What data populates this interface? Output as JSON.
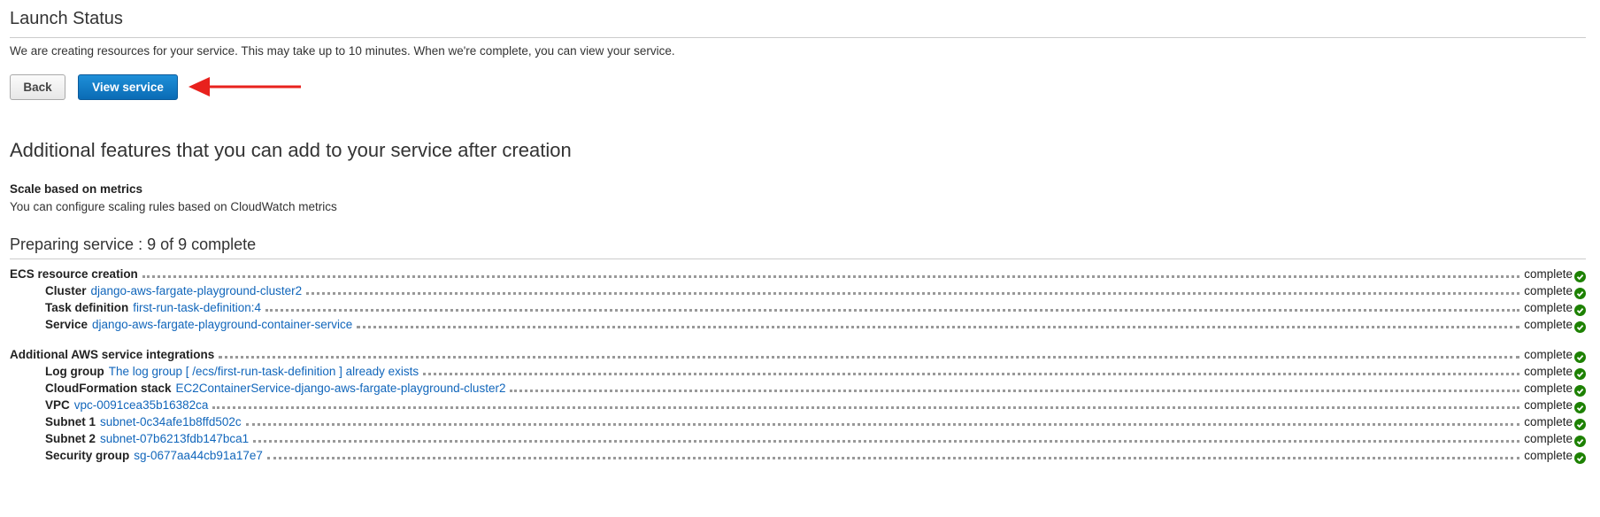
{
  "launch": {
    "title": "Launch Status",
    "description": "We are creating resources for your service. This may take up to 10 minutes. When we're complete, you can view your service.",
    "back_label": "Back",
    "view_label": "View service"
  },
  "additional": {
    "title": "Additional features that you can add to your service after creation",
    "scale_title": "Scale based on metrics",
    "scale_desc": "You can configure scaling rules based on CloudWatch metrics"
  },
  "preparing": {
    "title": "Preparing service : 9 of 9 complete",
    "ecs": {
      "label": "ECS resource creation",
      "status": "complete",
      "items": [
        {
          "label": "Cluster",
          "value": "django-aws-fargate-playground-cluster2",
          "status": "complete"
        },
        {
          "label": "Task definition",
          "value": "first-run-task-definition:4",
          "status": "complete"
        },
        {
          "label": "Service",
          "value": "django-aws-fargate-playground-container-service",
          "status": "complete"
        }
      ]
    },
    "aws": {
      "label": "Additional AWS service integrations",
      "status": "complete",
      "items": [
        {
          "label": "Log group",
          "value": "The log group [ /ecs/first-run-task-definition ] already exists",
          "status": "complete"
        },
        {
          "label": "CloudFormation stack",
          "value": "EC2ContainerService-django-aws-fargate-playground-cluster2",
          "status": "complete"
        },
        {
          "label": "VPC",
          "value": "vpc-0091cea35b16382ca",
          "status": "complete"
        },
        {
          "label": "Subnet 1",
          "value": "subnet-0c34afe1b8ffd502c",
          "status": "complete"
        },
        {
          "label": "Subnet 2",
          "value": "subnet-07b6213fdb147bca1",
          "status": "complete"
        },
        {
          "label": "Security group",
          "value": "sg-0677aa44cb91a17e7",
          "status": "complete"
        }
      ]
    }
  },
  "icons": {
    "status_check": "check-circle-icon",
    "annotation": "red-arrow-icon"
  },
  "colors": {
    "primary_button": "#0a6bb5",
    "link": "#1166bb",
    "success": "#1d8102",
    "annotation_arrow": "#e8211d"
  }
}
